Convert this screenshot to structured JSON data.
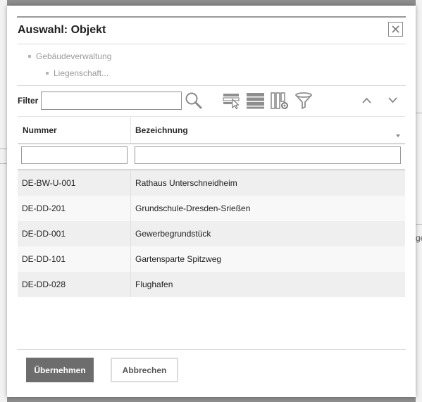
{
  "dialog": {
    "title": "Auswahl: Objekt",
    "breadcrumb": [
      {
        "label": "Gebäudeverwaltung"
      },
      {
        "label": "Liegenschaft..."
      }
    ],
    "filter_label": "Filter",
    "filter_value": "",
    "toolbar_icons": [
      "select-rows-icon",
      "list-view-icon",
      "column-settings-icon",
      "funnel-filter-icon",
      "chevron-up-icon",
      "chevron-down-icon"
    ]
  },
  "grid": {
    "columns": [
      {
        "label": "Nummer"
      },
      {
        "label": "Bezeichnung"
      }
    ],
    "column_filters": [
      "",
      ""
    ],
    "rows": [
      {
        "nummer": "DE-BW-U-001",
        "bezeichnung": "Rathaus Unterschneidheim"
      },
      {
        "nummer": "DE-DD-201",
        "bezeichnung": "Grundschule-Dresden-Srießen"
      },
      {
        "nummer": "DE-DD-001",
        "bezeichnung": "Gewerbegrundstück"
      },
      {
        "nummer": "DE-DD-101",
        "bezeichnung": "Gartensparte Spitzweg"
      },
      {
        "nummer": "DE-DD-028",
        "bezeichnung": "Flughafen"
      }
    ]
  },
  "buttons": {
    "accept": "Übernehmen",
    "cancel": "Abbrechen"
  },
  "background": {
    "fragment_right": "ge"
  },
  "colors": {
    "primary_button": "#6d6d6d",
    "overlay": "#8e8e8e"
  }
}
